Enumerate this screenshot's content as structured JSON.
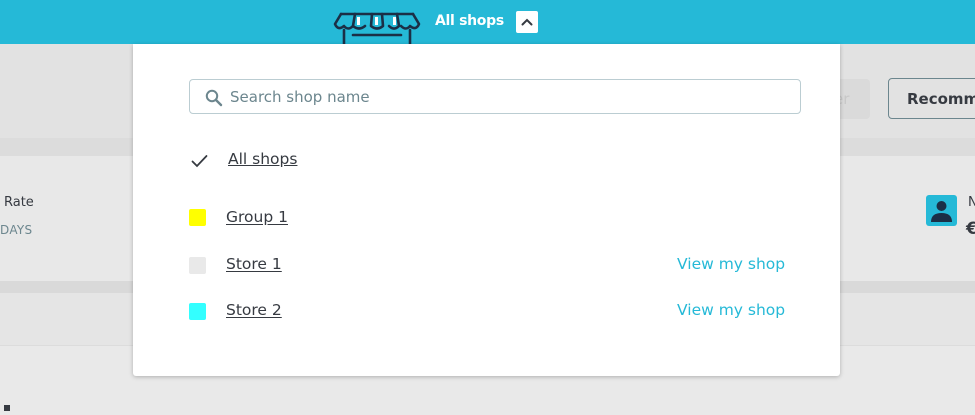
{
  "topbar": {
    "title": "All shops",
    "shop_icon": "storefront-icon",
    "toggle_icon": "chevron-up-icon",
    "color": "#25b9d7"
  },
  "background": {
    "ghost_button_fragment": "er",
    "recommend_button": "Recomm",
    "rate_label": "Rate",
    "days_label": "DAYS",
    "stat_letter": "N",
    "stat_symbol": "€"
  },
  "dropdown": {
    "search": {
      "placeholder": "Search shop name",
      "value": "",
      "icon": "search-icon"
    },
    "all_shops_label": "All shops",
    "rows": [
      {
        "label": "Group 1",
        "color": "#ffff00",
        "type": "group"
      },
      {
        "label": "Store 1",
        "color": "#e9e9e9",
        "type": "shop",
        "link": "View my shop"
      },
      {
        "label": "Store 2",
        "color": "#33ffff",
        "type": "shop",
        "link": "View my shop"
      }
    ]
  }
}
